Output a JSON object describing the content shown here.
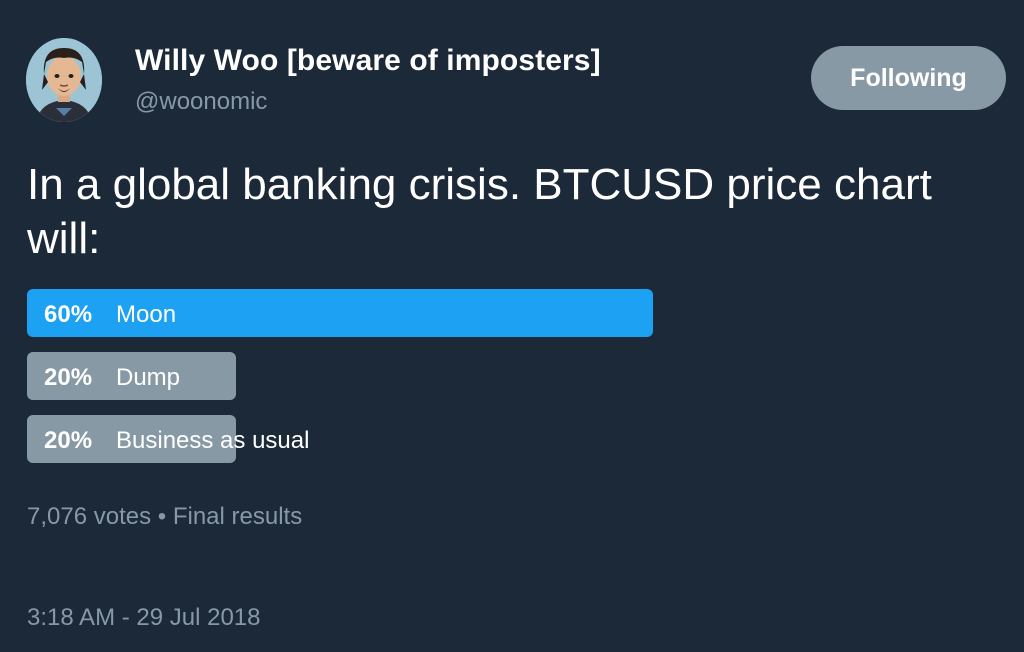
{
  "author": {
    "name": "Willy Woo [beware of imposters]",
    "handle": "@woonomic",
    "avatar_icon": "cartoon-avatar-icon"
  },
  "follow_button": {
    "label": "Following"
  },
  "tweet": {
    "text": "In a global banking crisis. BTCUSD price chart will:"
  },
  "poll": {
    "options": [
      {
        "percent_label": "60%",
        "label": "Moon",
        "fraction": 0.6,
        "winner": true
      },
      {
        "percent_label": "20%",
        "label": "Dump",
        "fraction": 0.2,
        "winner": false
      },
      {
        "percent_label": "20%",
        "label": "Business as usual",
        "fraction": 0.2,
        "winner": false
      }
    ],
    "votes": "7,076 votes",
    "separator": "•",
    "status": "Final results"
  },
  "timestamp": "3:18 AM - 29 Jul 2018",
  "colors": {
    "background": "#1c2938",
    "accent": "#1da1f2",
    "muted": "#8899a6",
    "text": "#ffffff"
  }
}
